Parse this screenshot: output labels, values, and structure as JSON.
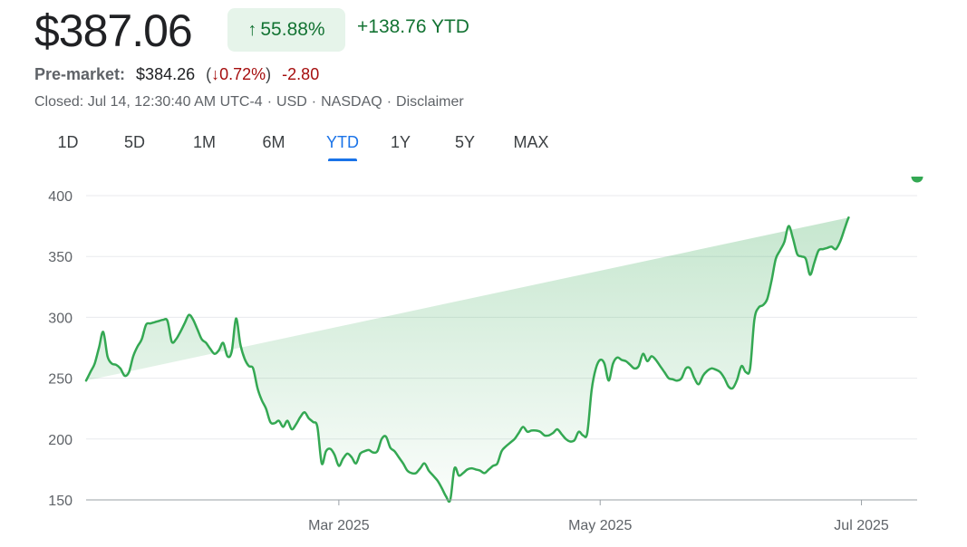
{
  "header": {
    "price": "$387.06",
    "change_pct": "55.88%",
    "change_abs": "+138.76 YTD",
    "premarket_label": "Pre-market:",
    "premarket_price": "$384.26",
    "premarket_change_pct": "0.72%",
    "premarket_change_abs": "-2.80",
    "meta": [
      "Closed: Jul 14, 12:30:40 AM UTC-4",
      "USD",
      "NASDAQ",
      "Disclaimer"
    ]
  },
  "tabs": [
    {
      "label": "1D",
      "active": false
    },
    {
      "label": "5D",
      "active": false
    },
    {
      "label": "1M",
      "active": false
    },
    {
      "label": "6M",
      "active": false
    },
    {
      "label": "YTD",
      "active": true
    },
    {
      "label": "1Y",
      "active": false
    },
    {
      "label": "5Y",
      "active": false
    },
    {
      "label": "MAX",
      "active": false
    }
  ],
  "colors": {
    "positive": "#137333",
    "negative": "#a50e0e",
    "line": "#34a853",
    "accent": "#1a73e8"
  },
  "chart_data": {
    "type": "area",
    "x_unit": "day of year 2025",
    "ylim": [
      150,
      400
    ],
    "yticks": [
      150,
      200,
      250,
      300,
      350,
      400
    ],
    "xticks": [
      {
        "label": "Mar 2025",
        "x": 60
      },
      {
        "label": "May 2025",
        "x": 121
      },
      {
        "label": "Jul 2025",
        "x": 182
      }
    ],
    "xlim": [
      1,
      195
    ],
    "grid": true,
    "x": [
      1,
      2,
      3,
      4,
      5,
      6,
      7,
      8,
      9,
      10,
      11,
      12,
      13,
      14,
      15,
      16,
      17,
      18,
      19,
      20,
      21,
      22,
      23,
      24,
      25,
      26,
      27,
      28,
      29,
      30,
      31,
      32,
      33,
      34,
      35,
      36,
      37,
      38,
      39,
      40,
      41,
      42,
      43,
      44,
      45,
      46,
      47,
      48,
      49,
      50,
      51,
      52,
      53,
      54,
      55,
      56,
      57,
      58,
      59,
      60,
      61,
      62,
      63,
      64,
      65,
      66,
      67,
      68,
      69,
      70,
      71,
      72,
      73,
      74,
      75,
      76,
      77,
      78,
      79,
      80,
      81,
      82,
      83,
      84,
      85,
      86,
      87,
      88,
      89,
      90,
      91,
      92,
      93,
      94,
      95,
      96,
      97,
      98,
      99,
      100,
      101,
      102,
      103,
      104,
      105,
      106,
      107,
      108,
      109,
      110,
      111,
      112,
      113,
      114,
      115,
      116,
      117,
      118,
      119,
      120,
      121,
      122,
      123,
      124,
      125,
      126,
      127,
      128,
      129,
      130,
      131,
      132,
      133,
      134,
      135,
      136,
      137,
      138,
      139,
      140,
      141,
      142,
      143,
      144,
      145,
      146,
      147,
      148,
      149,
      150,
      151,
      152,
      153,
      154,
      155,
      156,
      157,
      158,
      159,
      160,
      161,
      162,
      163,
      164,
      165,
      166,
      167,
      168,
      169,
      170,
      171,
      172,
      173,
      174,
      175,
      176,
      177,
      178,
      179,
      180,
      181,
      182,
      183,
      184,
      185,
      186,
      187,
      188,
      189,
      190,
      191,
      192,
      193,
      194,
      195
    ],
    "series": [
      {
        "values": [
          248,
          255,
          262,
          275,
          288,
          268,
          262,
          261,
          258,
          252,
          255,
          268,
          276,
          282,
          294,
          295,
          296,
          297,
          298,
          297,
          280,
          282,
          288,
          295,
          302,
          298,
          290,
          282,
          279,
          274,
          270,
          273,
          279,
          268,
          272,
          299,
          278,
          266,
          260,
          258,
          242,
          232,
          225,
          214,
          213,
          215,
          210,
          215,
          208,
          212,
          218,
          222,
          217,
          214,
          210,
          180,
          190,
          192,
          187,
          178,
          184,
          188,
          185,
          180,
          188,
          190,
          191,
          189,
          190,
          200,
          202,
          193,
          190,
          185,
          180,
          174,
          172,
          172,
          176,
          180,
          174,
          170,
          166,
          160,
          153,
          150,
          176,
          170,
          172,
          175,
          176,
          175,
          174,
          172,
          175,
          178,
          180,
          190,
          194,
          197,
          200,
          205,
          210,
          206,
          207,
          207,
          206,
          203,
          203,
          205,
          208,
          204,
          200,
          198,
          199,
          206,
          203,
          205,
          240,
          258,
          265,
          262,
          248,
          262,
          267,
          265,
          264,
          261,
          258,
          260,
          270,
          264,
          268,
          265,
          260,
          255,
          250,
          249,
          248,
          250,
          258,
          258,
          250,
          245,
          252,
          256,
          258,
          257,
          255,
          250,
          243,
          242,
          249,
          260,
          255,
          258,
          298,
          308,
          310,
          315,
          330,
          348,
          355,
          362,
          375,
          365,
          352,
          350,
          348,
          335,
          345,
          355,
          356,
          357,
          358,
          356,
          362,
          372,
          382,
          387
        ]
      }
    ]
  }
}
